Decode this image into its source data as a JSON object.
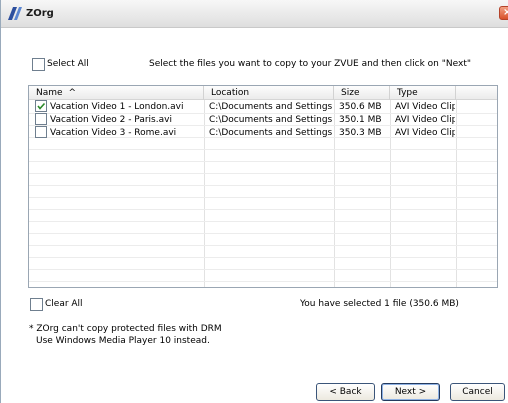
{
  "window": {
    "title": "ZOrg"
  },
  "select_all": {
    "label": "Select All",
    "checked": false
  },
  "instruction": "Select the files you want to copy to your ZVUE and then click on \"Next\"",
  "table": {
    "columns": [
      "Name",
      "Location",
      "Size",
      "Type"
    ],
    "sort_indicator": "^",
    "rows": [
      {
        "checked": true,
        "name": "Vacation Video 1 - London.avi",
        "location": "C:\\Documents and Settings\\...",
        "size": "350.6 MB",
        "type": "AVI Video Clip"
      },
      {
        "checked": false,
        "name": "Vacation Video 2 - Paris.avi",
        "location": "C:\\Documents and Settings\\...",
        "size": "350.1 MB",
        "type": "AVI Video Clip"
      },
      {
        "checked": false,
        "name": "Vacation Video 3 - Rome.avi",
        "location": "C:\\Documents and Settings\\...",
        "size": "350.3 MB",
        "type": "AVI Video Clip"
      }
    ]
  },
  "clear_all": {
    "label": "Clear All",
    "checked": false
  },
  "selection_status": "You have selected 1 file (350.6 MB)",
  "note": {
    "line1": "* ZOrg can't copy protected files with DRM",
    "line2": "Use Windows Media Player 10 instead."
  },
  "buttons": {
    "back": "< Back",
    "next": "Next >",
    "cancel": "Cancel"
  },
  "colors": {
    "accent": "#3b5579",
    "close": "#d9502a"
  },
  "icons": {
    "app": "zorg-logo-icon",
    "close": "close-icon",
    "check": "checkmark-icon"
  }
}
